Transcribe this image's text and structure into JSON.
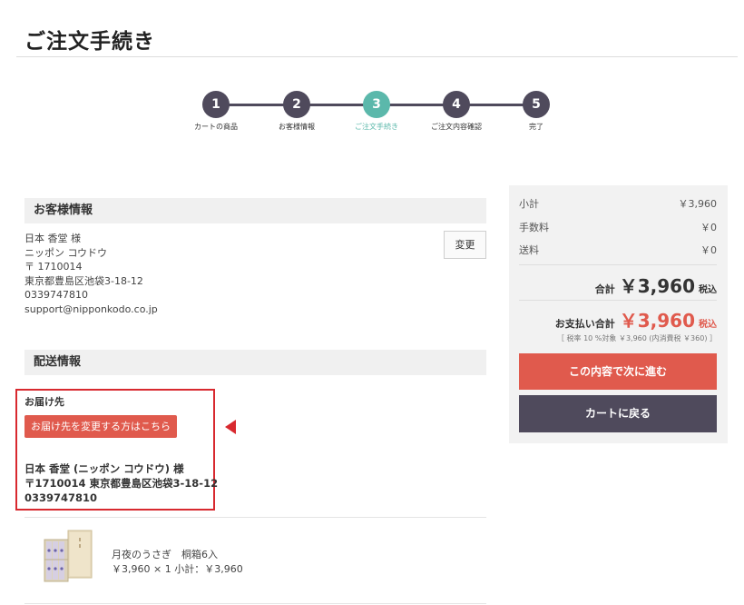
{
  "page": {
    "title": "ご注文手続き"
  },
  "steps": [
    {
      "num": "1",
      "label": "カートの商品",
      "active": false
    },
    {
      "num": "2",
      "label": "お客様情報",
      "active": false
    },
    {
      "num": "3",
      "label": "ご注文手続き",
      "active": true
    },
    {
      "num": "4",
      "label": "ご注文内容確認",
      "active": false
    },
    {
      "num": "5",
      "label": "完了",
      "active": false
    }
  ],
  "customer": {
    "header": "お客様情報",
    "lines": [
      "日本 香堂 様",
      "ニッポン コウドウ",
      "〒 1710014",
      "東京都豊島区池袋3-18-12",
      "0339747810",
      "support@nipponkodo.co.jp"
    ],
    "change_label": "変更"
  },
  "delivery": {
    "header": "配送情報",
    "title": "お届け先",
    "change_link": "お届け先を変更する方はこちら",
    "address_lines": [
      "日本 香堂 (ニッポン コウドウ) 様",
      "〒1710014 東京都豊島区池袋3-18-12",
      "0339747810"
    ]
  },
  "item": {
    "name": "月夜のうさぎ　桐箱6入",
    "price_line": "￥3,960 × 1  小計：￥3,960"
  },
  "summary": {
    "subtotal_label": "小計",
    "subtotal_value": "￥3,960",
    "fee_label": "手数料",
    "fee_value": "￥0",
    "shipping_label": "送料",
    "shipping_value": "￥0",
    "total_label": "合計",
    "total_value": "￥3,960",
    "total_tax": "税込",
    "pay_label": "お支払い合計",
    "pay_value": "￥3,960",
    "pay_tax": "税込",
    "tax_note": "［ 税率 10 %対象 ￥3,960 (内消費税 ￥360) ］",
    "next_button": "この内容で次に進む",
    "back_button": "カートに戻る"
  },
  "colors": {
    "accent_red": "#e05a4d",
    "step_dark": "#4f4a5c",
    "step_active": "#5bb8ab",
    "highlight_border": "#d8292f"
  }
}
